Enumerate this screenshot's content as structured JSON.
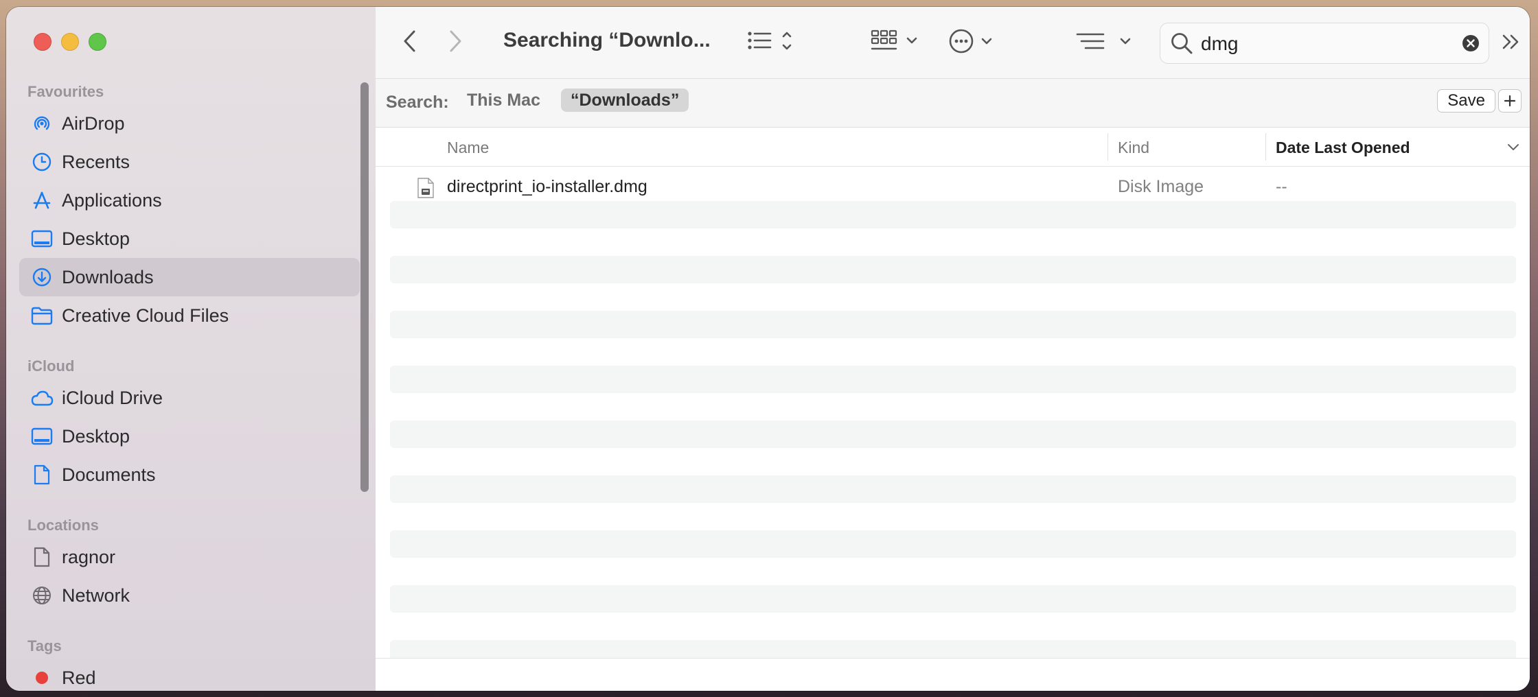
{
  "window": {
    "title": "Searching “Downlo..."
  },
  "sidebar": {
    "sections": [
      {
        "label": "Favourites",
        "items": [
          {
            "label": "AirDrop",
            "icon": "airdrop-icon"
          },
          {
            "label": "Recents",
            "icon": "clock-icon"
          },
          {
            "label": "Applications",
            "icon": "applications-icon"
          },
          {
            "label": "Desktop",
            "icon": "desktop-icon"
          },
          {
            "label": "Downloads",
            "icon": "downloads-icon",
            "selected": true
          },
          {
            "label": "Creative Cloud Files",
            "icon": "folder-icon"
          }
        ]
      },
      {
        "label": "iCloud",
        "items": [
          {
            "label": "iCloud Drive",
            "icon": "cloud-icon"
          },
          {
            "label": "Desktop",
            "icon": "desktop-icon"
          },
          {
            "label": "Documents",
            "icon": "document-icon"
          }
        ]
      },
      {
        "label": "Locations",
        "items": [
          {
            "label": "ragnor",
            "icon": "document-icon"
          },
          {
            "label": "Network",
            "icon": "globe-icon"
          }
        ]
      },
      {
        "label": "Tags",
        "items": [
          {
            "label": "Red",
            "icon": "tag-red-icon",
            "color": "#e8403a"
          }
        ]
      }
    ]
  },
  "search": {
    "value": "dmg"
  },
  "scope": {
    "label": "Search:",
    "options": [
      {
        "label": "This Mac",
        "active": false
      },
      {
        "label": "“Downloads”",
        "active": true
      }
    ],
    "save_label": "Save"
  },
  "columns": {
    "name": "Name",
    "kind": "Kind",
    "date": "Date Last Opened"
  },
  "files": [
    {
      "name": "directprint_io-installer.dmg",
      "kind": "Disk Image",
      "date_opened": "--"
    }
  ],
  "colors": {
    "accent": "#1a7cf0",
    "selection": "#d0c9cf"
  }
}
